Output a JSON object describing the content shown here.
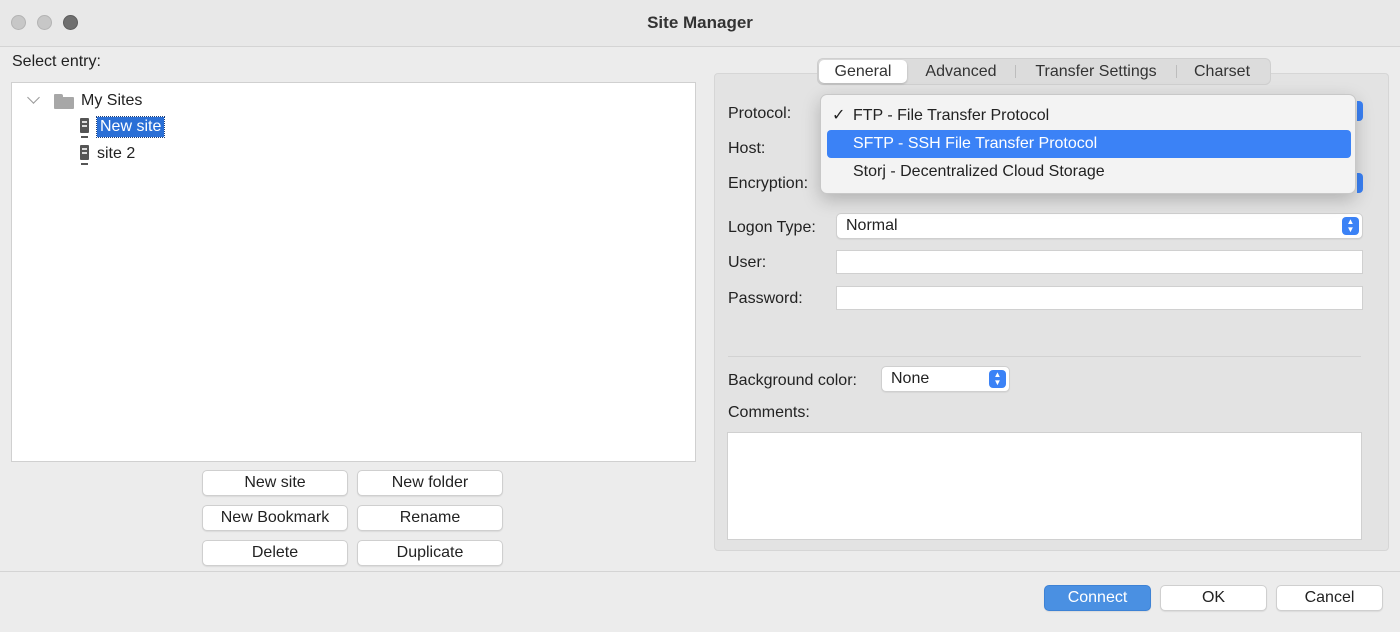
{
  "window": {
    "title": "Site Manager"
  },
  "select_entry_label": "Select entry:",
  "tree": {
    "root": {
      "label": "My Sites",
      "icon": "folder-icon",
      "expanded": true
    },
    "children": [
      {
        "label": "New site",
        "icon": "server-icon",
        "selected": true
      },
      {
        "label": "site 2",
        "icon": "server-icon",
        "selected": false
      }
    ]
  },
  "left_buttons": {
    "new_site": "New site",
    "new_folder": "New folder",
    "new_bookmark": "New Bookmark",
    "rename": "Rename",
    "delete": "Delete",
    "duplicate": "Duplicate"
  },
  "tabs": [
    {
      "label": "General",
      "active": true
    },
    {
      "label": "Advanced",
      "active": false
    },
    {
      "label": "Transfer Settings",
      "active": false
    },
    {
      "label": "Charset",
      "active": false
    }
  ],
  "general": {
    "protocol_label": "Protocol:",
    "host_label": "Host:",
    "encryption_label": "Encryption:",
    "logon_type_label": "Logon Type:",
    "logon_type_value": "Normal",
    "user_label": "User:",
    "user_value": "",
    "password_label": "Password:",
    "password_value": "",
    "background_color_label": "Background color:",
    "background_color_value": "None",
    "comments_label": "Comments:",
    "comments_value": ""
  },
  "protocol_dropdown": {
    "options": [
      {
        "label": "FTP - File Transfer Protocol",
        "checked": true,
        "highlighted": false
      },
      {
        "label": "SFTP - SSH File Transfer Protocol",
        "checked": false,
        "highlighted": true
      },
      {
        "label": "Storj - Decentralized Cloud Storage",
        "checked": false,
        "highlighted": false
      }
    ],
    "check_glyph": "✓"
  },
  "footer_buttons": {
    "connect": "Connect",
    "ok": "OK",
    "cancel": "Cancel"
  },
  "colors": {
    "accent": "#3b82f6",
    "selection": "#2a6fd6",
    "primary_button": "#4a90e2"
  }
}
